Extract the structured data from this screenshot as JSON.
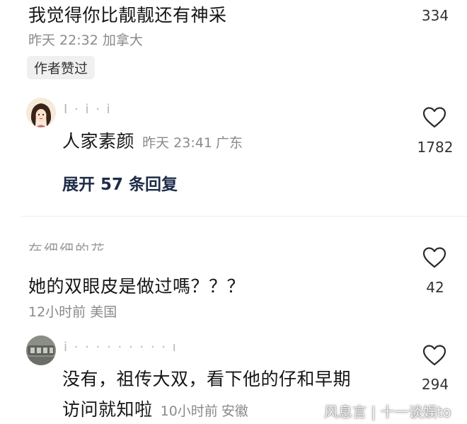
{
  "comments": [
    {
      "text": "我觉得你比靓靓还有神采",
      "time": "昨天 22:32",
      "location": "加拿大",
      "likes": "334",
      "badge": "作者赞过",
      "reply": {
        "username": "I · i · i",
        "text": "人家素颜",
        "time": "昨天 23:41",
        "location": "广东",
        "likes": "1782"
      },
      "expand": "展开 57 条回复"
    },
    {
      "username": "在细细的花",
      "text": "她的双眼皮是做过嗎？？？",
      "time": "12小时前",
      "location": "美国",
      "likes": "42",
      "reply": {
        "username": "i · · · · · · · · · ı",
        "text_line1": "没有，祖传大双，看下他的仔和早期",
        "text_line2": "访问就知啦",
        "time": "10小时前",
        "location": "安徽",
        "likes": "294"
      }
    }
  ],
  "watermark": "风息言 | 十一谈娱to",
  "icons": {
    "like": "heart-outline-icon"
  }
}
